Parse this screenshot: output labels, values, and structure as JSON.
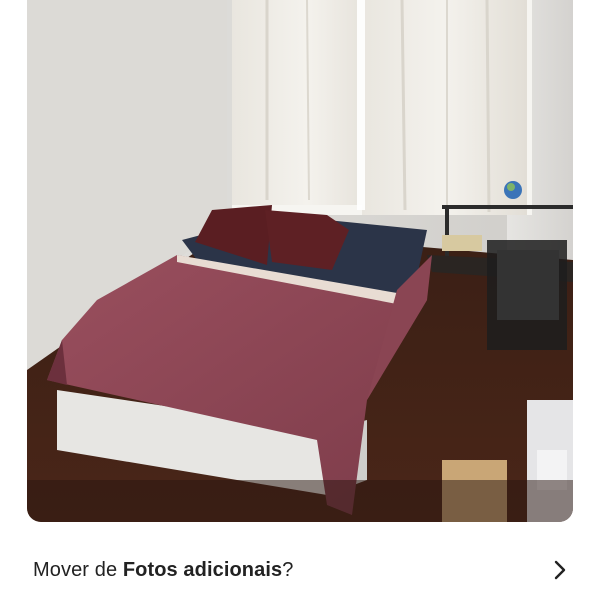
{
  "photo": {
    "subject": "bedroom-photo"
  },
  "move_prompt": {
    "prefix": "Mover de ",
    "album": "Fotos adicionais",
    "suffix": "?"
  },
  "icons": {
    "chevron": "chevron-right-icon"
  }
}
